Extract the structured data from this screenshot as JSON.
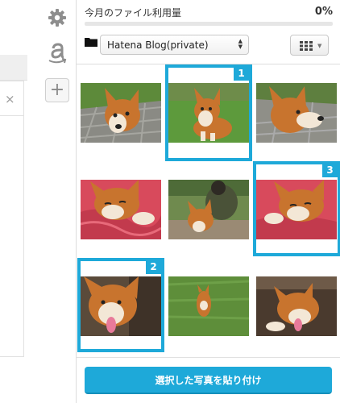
{
  "header": {
    "usage_label": "今月のファイル利用量",
    "usage_value": "0%",
    "usage_fraction": 0.0
  },
  "toolbar": {
    "album_selected": "Hatena Blog(private)",
    "folder_icon": "folder-icon",
    "view_icon": "grid-view-icon"
  },
  "tools": {
    "settings_icon": "gear-icon",
    "amazon_icon": "amazon-icon",
    "add_icon": "plus-icon",
    "add_symbol": "+"
  },
  "editor": {
    "close_symbol": "×"
  },
  "photos": [
    {
      "id": 1,
      "subject": "corgi face closeup on pavement",
      "selection": ""
    },
    {
      "id": 2,
      "subject": "corgi standing on grass",
      "selection": "1"
    },
    {
      "id": 3,
      "subject": "corgi profile on pavement",
      "selection": ""
    },
    {
      "id": 4,
      "subject": "corgi lying on pink blanket",
      "selection": ""
    },
    {
      "id": 5,
      "subject": "person with corgi outdoors",
      "selection": ""
    },
    {
      "id": 6,
      "subject": "corgi resting on pink blanket",
      "selection": "3"
    },
    {
      "id": 7,
      "subject": "corgi smiling with tongue out",
      "selection": "2"
    },
    {
      "id": 8,
      "subject": "small corgi on lawn",
      "selection": ""
    },
    {
      "id": 9,
      "subject": "corgi lying with tongue out",
      "selection": ""
    }
  ],
  "actions": {
    "paste_label": "選択した写真を貼り付け"
  },
  "colors": {
    "accent": "#1ea9d9",
    "border": "#dcdcdc"
  }
}
